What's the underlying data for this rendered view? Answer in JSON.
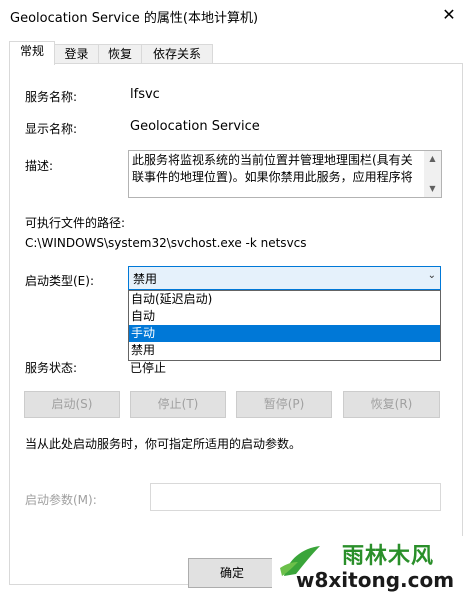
{
  "window": {
    "title": "Geolocation Service 的属性(本地计算机)",
    "close": "✕"
  },
  "tabs": [
    "常规",
    "登录",
    "恢复",
    "依存关系"
  ],
  "fields": {
    "service_name_label": "服务名称:",
    "service_name_value": "lfsvc",
    "display_name_label": "显示名称:",
    "display_name_value": "Geolocation Service",
    "description_label": "描述:",
    "description_text": "此服务将监视系统的当前位置并管理地理围栏(具有关联事件的地理位置)。如果你禁用此服务，应用程序将",
    "path_label": "可执行文件的路径:",
    "path_value": "C:\\WINDOWS\\system32\\svchost.exe -k netsvcs",
    "startup_type_label": "启动类型(E):",
    "startup_type_value": "禁用",
    "startup_options": [
      "自动(延迟启动)",
      "自动",
      "手动",
      "禁用"
    ],
    "selected_option_index": 2,
    "status_label": "服务状态:",
    "status_value": "已停止"
  },
  "buttons": {
    "start": "启动(S)",
    "stop": "停止(T)",
    "pause": "暂停(P)",
    "resume": "恢复(R)",
    "ok": "确定"
  },
  "hint": "当从此处启动服务时，你可指定所适用的启动参数。",
  "params_label": "启动参数(M):",
  "watermark": {
    "top": "雨林木风",
    "bottom": "w8xitong.com"
  }
}
